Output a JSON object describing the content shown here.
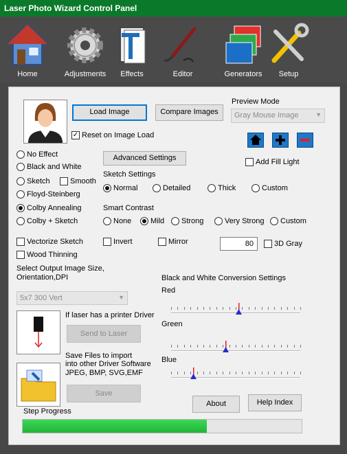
{
  "window": {
    "title": "Laser Photo Wizard Control Panel"
  },
  "toolbar": [
    {
      "label": "Home",
      "icon": "house-icon"
    },
    {
      "label": "Adjustments",
      "icon": "gear-icon"
    },
    {
      "label": "Effects",
      "icon": "effects-icon"
    },
    {
      "label": "Editor",
      "icon": "brush-icon"
    },
    {
      "label": "Generators",
      "icon": "layers-icon"
    },
    {
      "label": "Setup",
      "icon": "tools-icon"
    }
  ],
  "buttons": {
    "load_image": "Load Image",
    "compare_images": "Compare Images",
    "advanced_settings": "Advanced Settings",
    "send_to_laser": "Send to Laser",
    "save": "Save",
    "about": "About",
    "help_index": "Help Index"
  },
  "preview": {
    "label": "Preview Mode",
    "selected": "Gray Mouse Image",
    "add_fill_light": "Add Fill Light"
  },
  "reset_on_load": {
    "label": "Reset on Image Load",
    "checked": true
  },
  "effects": {
    "no_effect": "No Effect",
    "black_and_white": "Black and White",
    "sketch": "Sketch",
    "smooth": "Smooth",
    "floyd_steinberg": "Floyd-Steinberg",
    "colby_annealing": "Colby Annealing",
    "colby_sketch": "Colby + Sketch",
    "selected": "colby_annealing"
  },
  "sketch_settings": {
    "label": "Sketch Settings",
    "options": [
      "Normal",
      "Detailed",
      "Thick",
      "Custom"
    ],
    "selected": "Normal"
  },
  "smart_contrast": {
    "label": "Smart Contrast",
    "options": [
      "None",
      "Mild",
      "Strong",
      "Very Strong",
      "Custom"
    ],
    "selected": "Mild"
  },
  "options": {
    "vectorize_sketch": "Vectorize Sketch",
    "invert": "Invert",
    "mirror": "Mirror",
    "wood_thinning": "Wood Thinning",
    "gray_3d": "3D Gray",
    "value": "80"
  },
  "output": {
    "label": "Select Output Image Size, Orientation,DPI",
    "selected": "5x7 300 Vert"
  },
  "driver": {
    "label": "If laser has a printer Driver"
  },
  "save_files": {
    "line1": "Save Files to import",
    "line2": "into other Driver Software",
    "line3": "JPEG, BMP, SVG,EMF"
  },
  "bw_conversion": {
    "label": "Black and White Conversion Settings",
    "sliders": [
      {
        "name": "Red",
        "value": 0.52
      },
      {
        "name": "Green",
        "value": 0.42
      },
      {
        "name": "Blue",
        "value": 0.17
      }
    ]
  },
  "progress": {
    "label": "Step Progress",
    "value": 0.66
  },
  "colors": {
    "titlebar": "#0a7a2a",
    "progress": "#22c23c"
  }
}
